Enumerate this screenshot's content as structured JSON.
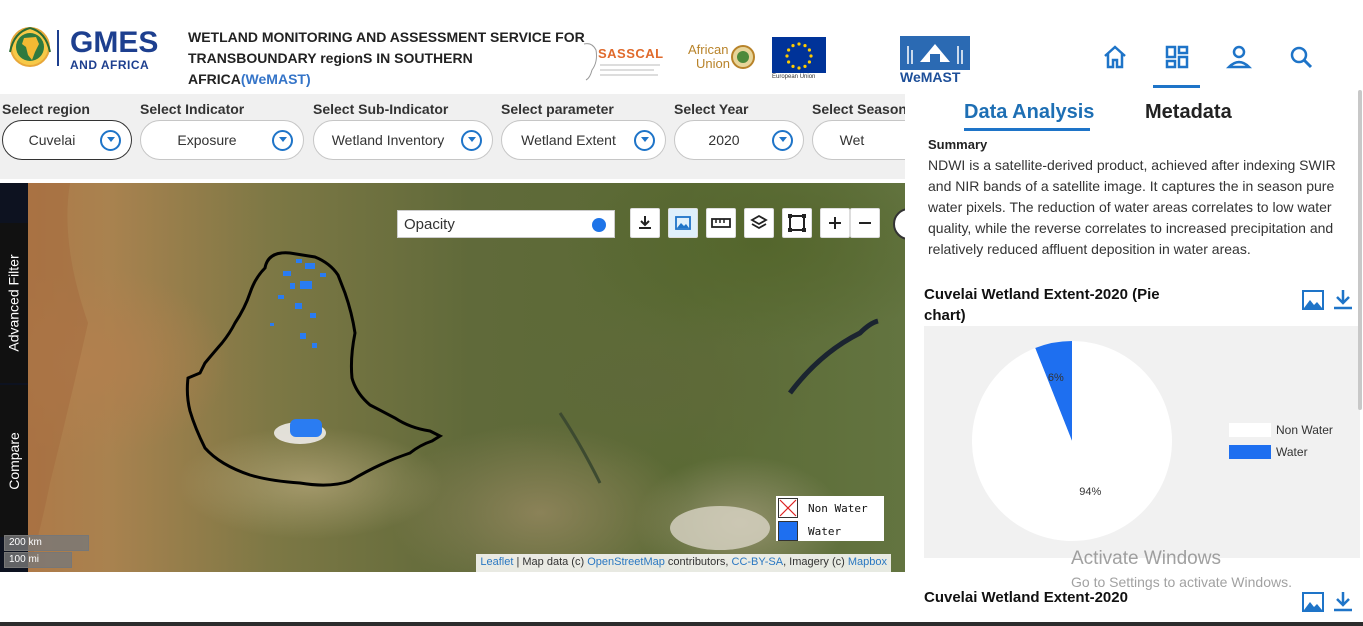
{
  "header": {
    "logo_primary": "GMES",
    "logo_secondary": "AND AFRICA",
    "title_main": "WETLAND MONITORING AND ASSESSMENT SERVICE FOR TRANSBOUNDARY regionS IN SOUTHERN AFRICA",
    "title_acronym": "(WeMAST)",
    "partners": {
      "sasscal": "SASSCAL",
      "african_union_line1": "African",
      "african_union_line2": "Union",
      "european_union": "European Union",
      "wemast": "WeMAST"
    },
    "nav_icons": [
      "home-icon",
      "dashboard-icon",
      "user-icon",
      "search-icon"
    ]
  },
  "filters": [
    {
      "label": "Select region",
      "value": "Cuvelai"
    },
    {
      "label": "Select Indicator",
      "value": "Exposure"
    },
    {
      "label": "Select Sub-Indicator",
      "value": "Wetland Inventory"
    },
    {
      "label": "Select parameter",
      "value": "Wetland Extent"
    },
    {
      "label": "Select Year",
      "value": "2020"
    },
    {
      "label": "Select Season",
      "value": "Wet"
    }
  ],
  "map": {
    "side_tabs": {
      "advanced": "Advanced Filter",
      "compare": "Compare"
    },
    "opacity_label": "Opacity",
    "tools": [
      "download-icon",
      "image-icon",
      "ruler-icon",
      "layers-icon",
      "square-select-icon",
      "zoom-in-icon",
      "zoom-out-icon"
    ],
    "legend": [
      {
        "label": "Non Water",
        "color": "#ffffff"
      },
      {
        "label": "Water",
        "color": "#1e6ff0"
      }
    ],
    "scale": {
      "km": "200 km",
      "mi": "100 mi"
    },
    "attribution": {
      "leaflet": "Leaflet",
      "sep1": " | Map data (c) ",
      "osm": "OpenStreetMap",
      "sep2": " contributors, ",
      "license": "CC-BY-SA",
      "sep3": ", Imagery (c) ",
      "mapbox": "Mapbox"
    }
  },
  "panel": {
    "tabs": {
      "analysis": "Data Analysis",
      "metadata": "Metadata"
    },
    "summary_heading": "Summary",
    "summary_text": "NDWI is a satellite-derived product, achieved after indexing SWIR and NIR bands of a satellite image. It captures the in season pure water pixels. The reduction of water areas correlates to low water quality, while the reverse correlates to increased precipitation and relatively reduced affluent deposition in water areas.",
    "chart1_title": "Cuvelai Wetland Extent-2020 (Pie chart)",
    "chart2_title": "Cuvelai Wetland Extent-2020"
  },
  "watermark": {
    "line1": "Activate Windows",
    "line2": "Go to Settings to activate Windows."
  },
  "chart_data": {
    "type": "pie",
    "categories": [
      "Non Water",
      "Water"
    ],
    "values": [
      94,
      6
    ],
    "labels": [
      "94%",
      "6%"
    ],
    "colors": [
      "#ffffff",
      "#1e6ff0"
    ],
    "legend_position": "right"
  }
}
